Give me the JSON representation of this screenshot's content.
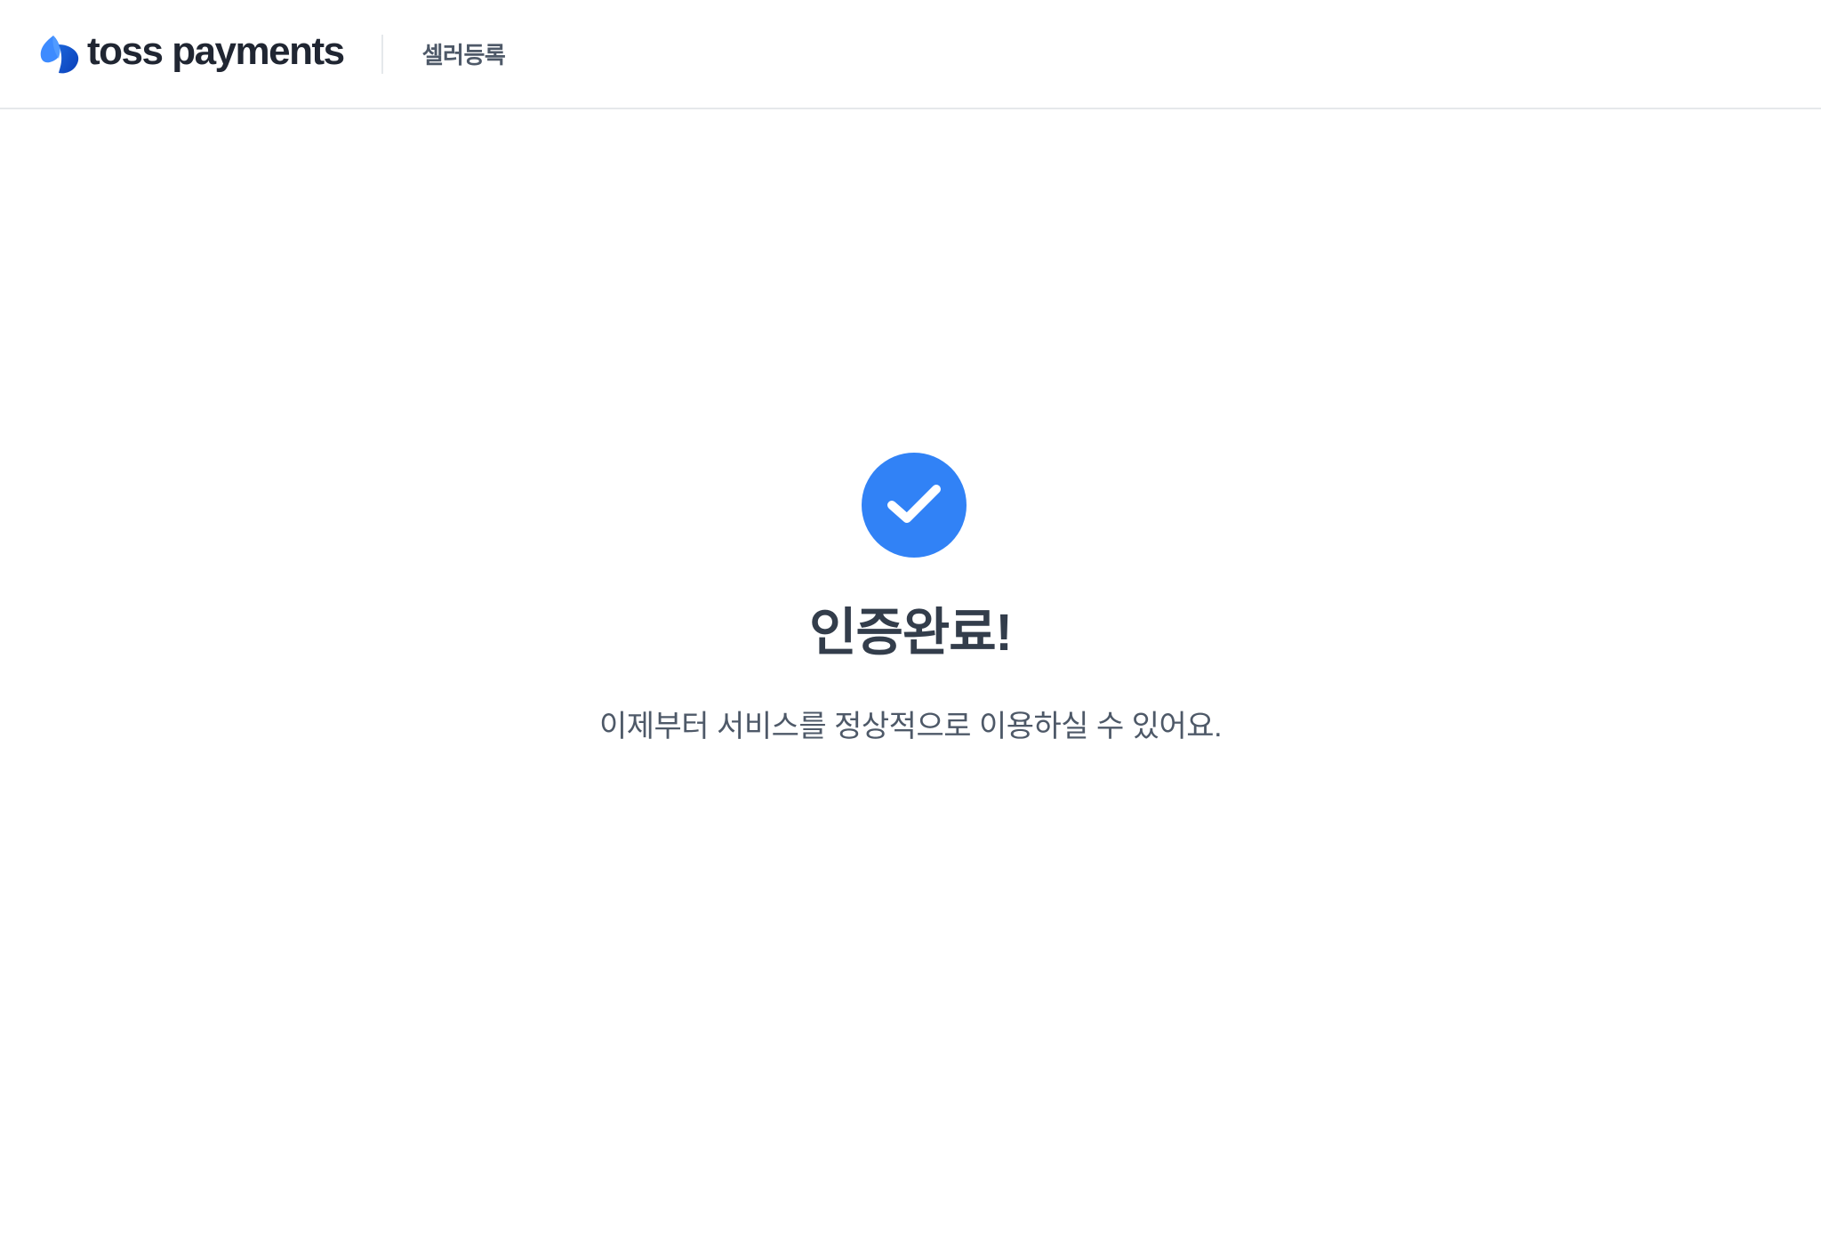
{
  "header": {
    "logo_text": "toss payments",
    "logo_icon": "toss-logo-icon",
    "nav_label": "셀러등록"
  },
  "main": {
    "status_icon": "check-circle-icon",
    "title": "인증완료!",
    "message": "이제부터 서비스를 정상적으로 이용하실 수 있어요."
  },
  "colors": {
    "brand_blue": "#3182f6",
    "title_text": "#333d4b",
    "body_text": "#4e5968",
    "divider": "#e5e8eb"
  }
}
